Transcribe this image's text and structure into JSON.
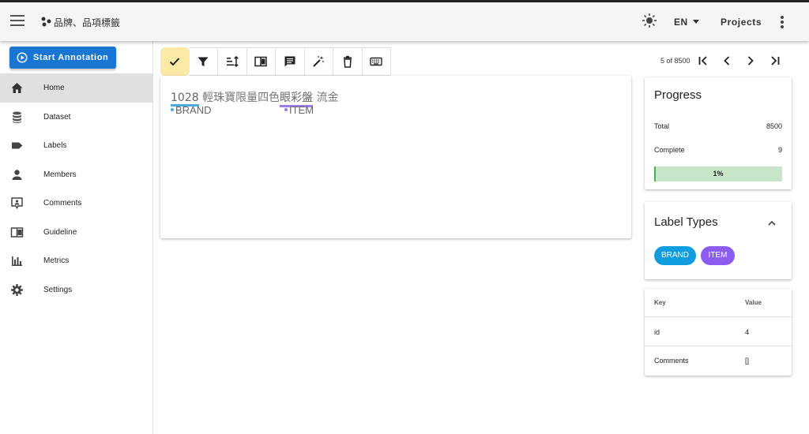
{
  "header": {
    "app_title": "品牌、品項標籤",
    "lang": "EN",
    "projects_label": "Projects"
  },
  "sidebar": {
    "start_label": "Start Annotation",
    "items": [
      {
        "label": "Home",
        "icon": "home-icon"
      },
      {
        "label": "Dataset",
        "icon": "database-icon"
      },
      {
        "label": "Labels",
        "icon": "label-icon"
      },
      {
        "label": "Members",
        "icon": "person-icon"
      },
      {
        "label": "Comments",
        "icon": "comment-account-icon"
      },
      {
        "label": "Guideline",
        "icon": "book-open-icon"
      },
      {
        "label": "Metrics",
        "icon": "chart-bar-icon"
      },
      {
        "label": "Settings",
        "icon": "gear-icon"
      }
    ]
  },
  "pager": {
    "text": "5 of 8500"
  },
  "document": {
    "brand_text": "1028",
    "middle_text": " 輕珠寶限量四色",
    "item_text": "眼彩盤",
    "tail_text": " 流金",
    "brand_label": "BRAND",
    "item_label": "ITEM"
  },
  "progress": {
    "title": "Progress",
    "total_label": "Total",
    "total_value": "8500",
    "complete_label": "Complete",
    "complete_value": "9",
    "percent_text": "1%",
    "percent": 1
  },
  "label_types": {
    "title": "Label Types",
    "chips": [
      {
        "label": "BRAND",
        "color": "#0f9de0"
      },
      {
        "label": "ITEM",
        "color": "#8c5cf0"
      }
    ]
  },
  "metadata": {
    "key_header": "Key",
    "value_header": "Value",
    "rows": [
      {
        "key": "id",
        "value": "4"
      },
      {
        "key": "Comments",
        "value": "[]"
      }
    ]
  },
  "colors": {
    "accent": "#1976d2",
    "brand_underline": "#4dabd9",
    "item_underline": "#9b7be8",
    "progress_fill": "#4caf50",
    "progress_track": "#c8e6c9",
    "highlight": "#fbe9a6"
  }
}
